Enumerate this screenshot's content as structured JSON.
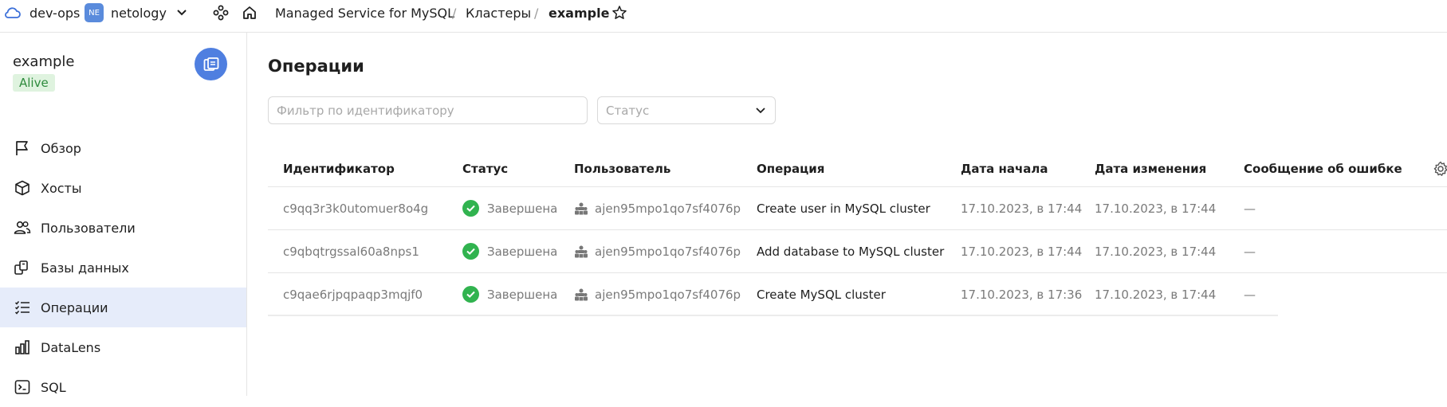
{
  "topbar": {
    "cloud_name": "dev-ops",
    "org_badge": "NE",
    "org_name": "netology",
    "breadcrumbs": [
      "Managed Service for MySQL",
      "Кластеры",
      "example"
    ],
    "separator": "/"
  },
  "sidebar": {
    "cluster_name": "example",
    "cluster_status": "Alive",
    "items": [
      {
        "label": "Обзор",
        "icon": "flag-icon"
      },
      {
        "label": "Хосты",
        "icon": "cube-icon"
      },
      {
        "label": "Пользователи",
        "icon": "users-icon"
      },
      {
        "label": "Базы данных",
        "icon": "databases-icon"
      },
      {
        "label": "Операции",
        "icon": "operations-list-icon",
        "active": true
      },
      {
        "label": "DataLens",
        "icon": "bar-chart-icon"
      },
      {
        "label": "SQL",
        "icon": "terminal-icon"
      }
    ]
  },
  "main": {
    "title": "Операции",
    "filter_placeholder": "Фильтр по идентификатору",
    "status_placeholder": "Статус",
    "columns": [
      "Идентификатор",
      "Статус",
      "Пользователь",
      "Операция",
      "Дата начала",
      "Дата изменения",
      "Сообщение об ошибке"
    ],
    "rows": [
      {
        "id": "c9qq3r3k0utomuer8o4g",
        "status": "Завершена",
        "user": "ajen95mpo1qo7sf4076p",
        "operation": "Create user in MySQL cluster",
        "started": "17.10.2023, в 17:44",
        "modified": "17.10.2023, в 17:44",
        "error": "—"
      },
      {
        "id": "c9qbqtrgssal60a8nps1",
        "status": "Завершена",
        "user": "ajen95mpo1qo7sf4076p",
        "operation": "Add database to MySQL cluster",
        "started": "17.10.2023, в 17:44",
        "modified": "17.10.2023, в 17:44",
        "error": "—"
      },
      {
        "id": "c9qae6rjpqpaqp3mqjf0",
        "status": "Завершена",
        "user": "ajen95mpo1qo7sf4076p",
        "operation": "Create MySQL cluster",
        "started": "17.10.2023, в 17:36",
        "modified": "17.10.2023, в 17:44",
        "error": "—"
      }
    ]
  },
  "colors": {
    "accent": "#4f7fe0",
    "active_nav_bg": "#e6ecfa",
    "success": "#31b34f",
    "alive_bg": "#dff3df",
    "alive_text": "#2e8b3d"
  }
}
